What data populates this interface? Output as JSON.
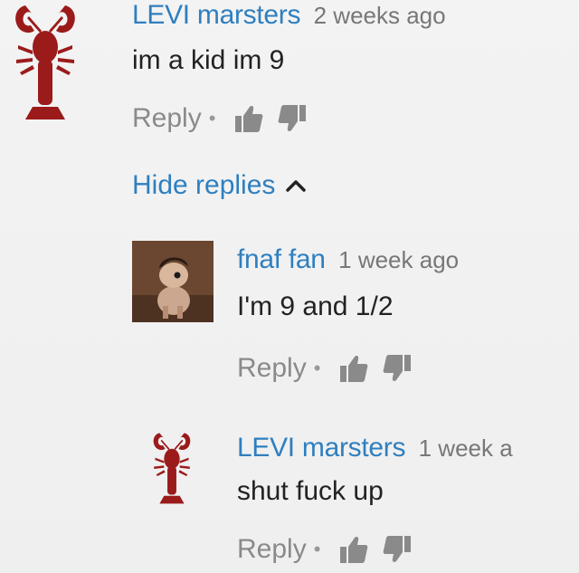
{
  "comments": [
    {
      "author": "LEVI marsters",
      "time": "2 weeks ago",
      "text": "im a kid im 9",
      "reply_label": "Reply",
      "separator": "•"
    }
  ],
  "hide_replies_label": "Hide replies",
  "replies": [
    {
      "author": "fnaf fan",
      "time": "1 week ago",
      "text": "I'm 9 and 1/2",
      "reply_label": "Reply",
      "separator": "•"
    },
    {
      "author": "LEVI marsters",
      "time": "1 week a",
      "text": "shut fuck up",
      "reply_label": "Reply",
      "separator": "•"
    }
  ],
  "colors": {
    "author": "#2f7fbf",
    "lobster": "#9b1b1b",
    "muted": "#8a8a8a"
  },
  "icons": {
    "avatar_main": "lobster-icon",
    "avatar_reply1": "pony-avatar",
    "avatar_reply2": "lobster-icon",
    "like": "thumbs-up-icon",
    "dislike": "thumbs-down-icon",
    "collapse": "chevron-up-icon"
  }
}
